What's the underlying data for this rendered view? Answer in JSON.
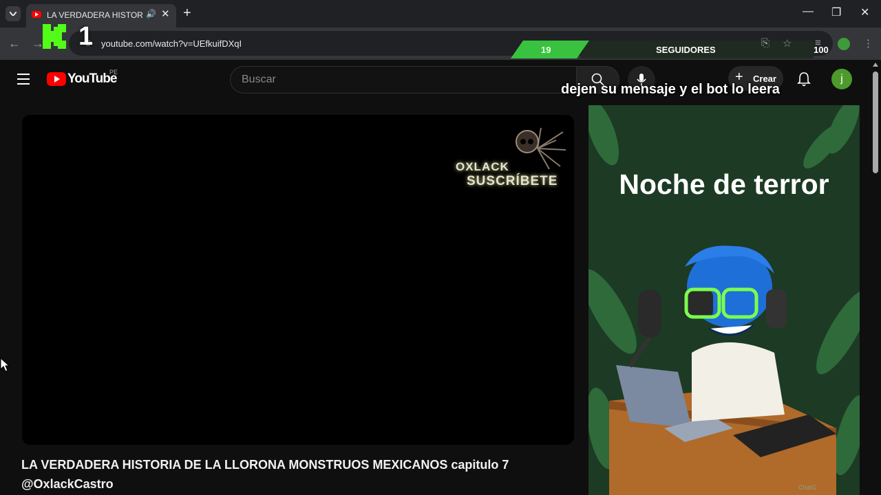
{
  "browser": {
    "tab_title": "LA VERDADERA HISTORIA DE",
    "url": "youtube.com/watch?v=UEfkuifDXqI",
    "window_controls": [
      "minimize-icon",
      "restore-icon",
      "close-icon"
    ]
  },
  "stream_overlay": {
    "kick_count": "1",
    "followers_current": "19",
    "followers_label": "SEGUIDORES",
    "followers_goal": "100",
    "message": "dejen su mensaje y el bot lo leera",
    "accent": "#39c240"
  },
  "youtube": {
    "logo_text": "YouTube",
    "country_code": "PE",
    "search_placeholder": "Buscar",
    "create_label": "Crear",
    "avatar_letter": "j",
    "video_title": "LA VERDADERA HISTORIA DE LA LLORONA MONSTRUOS MEXICANOS capitulo 7 @OxlackCastro",
    "watermark_line1": "OXLACK",
    "watermark_line2": "SUSCRÍBETE"
  },
  "side_panel": {
    "title": "Noche de terror",
    "corner_text": "ChatG"
  }
}
